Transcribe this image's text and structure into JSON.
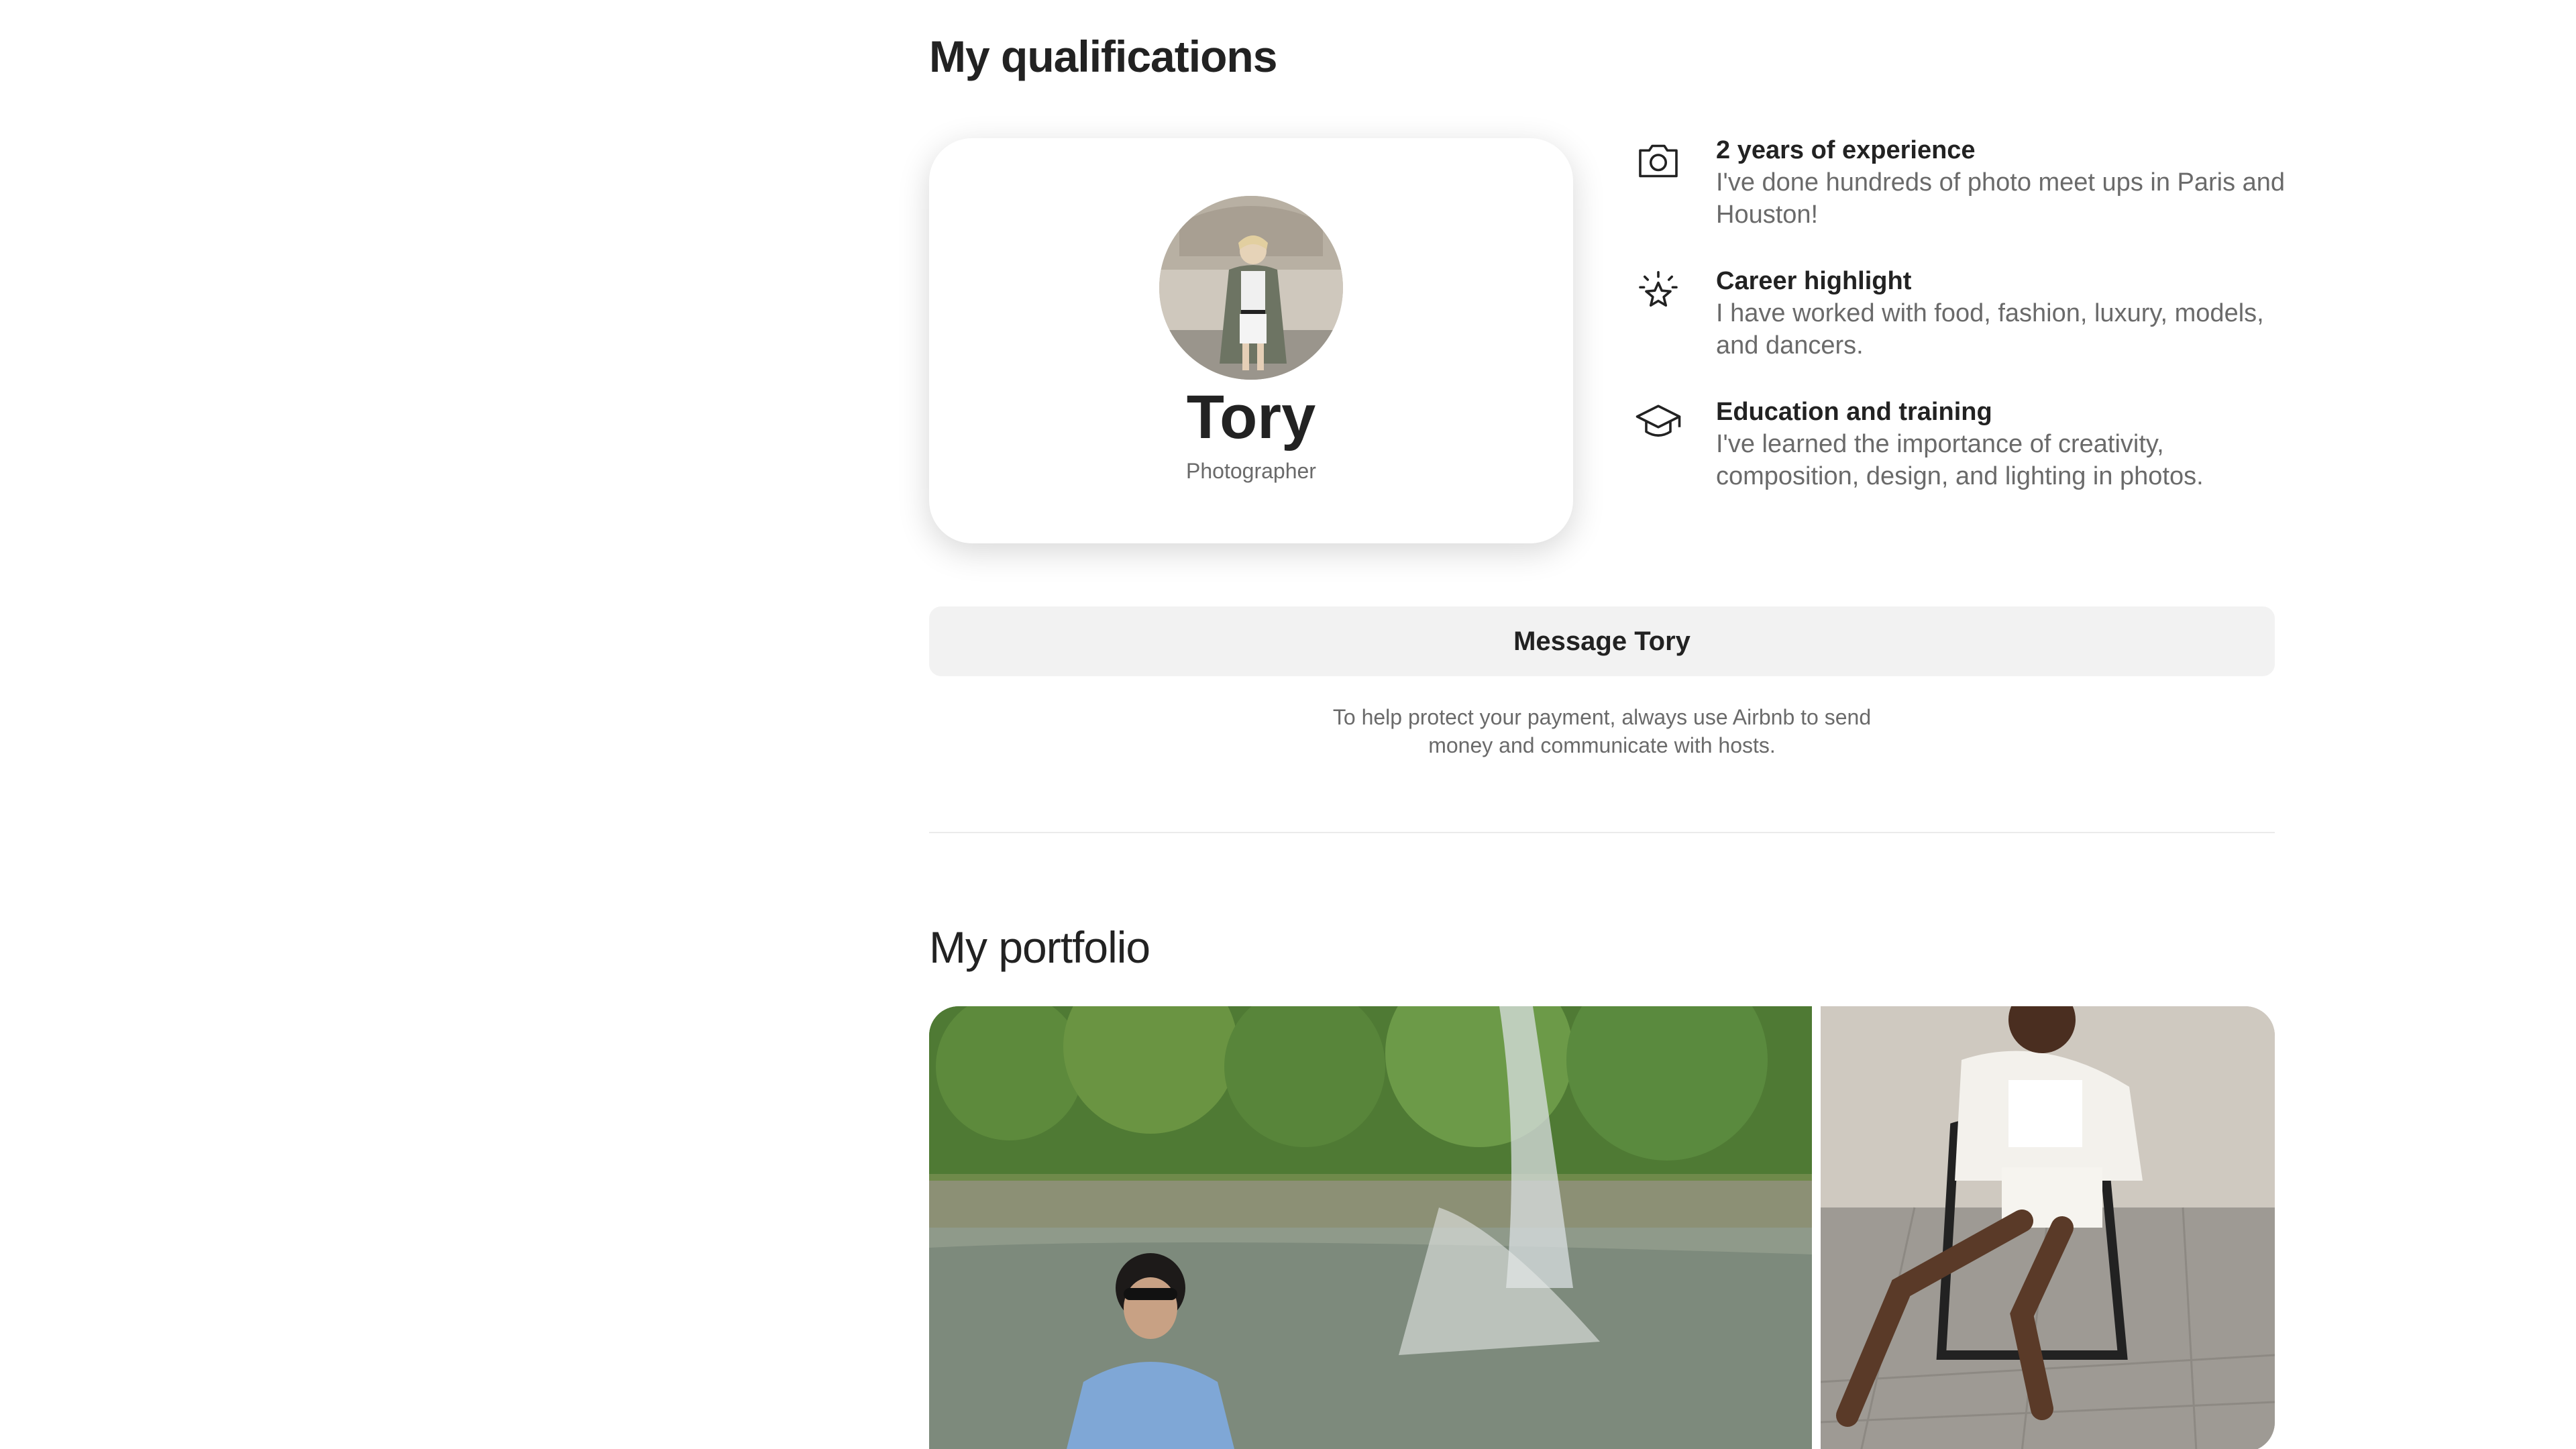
{
  "qualifications": {
    "title": "My qualifications",
    "items": [
      {
        "icon": "camera-icon",
        "heading": "2 years of experience",
        "description": "I've done hundreds of photo meet ups in Paris and Houston!"
      },
      {
        "icon": "star-icon",
        "heading": "Career highlight",
        "description": "I have worked with food, fashion, luxury, models, and dancers."
      },
      {
        "icon": "graduation-cap-icon",
        "heading": "Education and training",
        "description": "I've learned the importance of creativity, composition, design, and lighting in photos."
      }
    ]
  },
  "host": {
    "name": "Tory",
    "role": "Photographer"
  },
  "message_button": {
    "label": "Message Tory"
  },
  "payment_note": "To help protect your payment, always use Airbnb to send money and communicate with hosts.",
  "portfolio": {
    "title": "My portfolio"
  },
  "colors": {
    "text_primary": "#222222",
    "text_secondary": "#6a6a6a",
    "button_bg": "#f2f2f2",
    "divider": "#ebebeb"
  }
}
